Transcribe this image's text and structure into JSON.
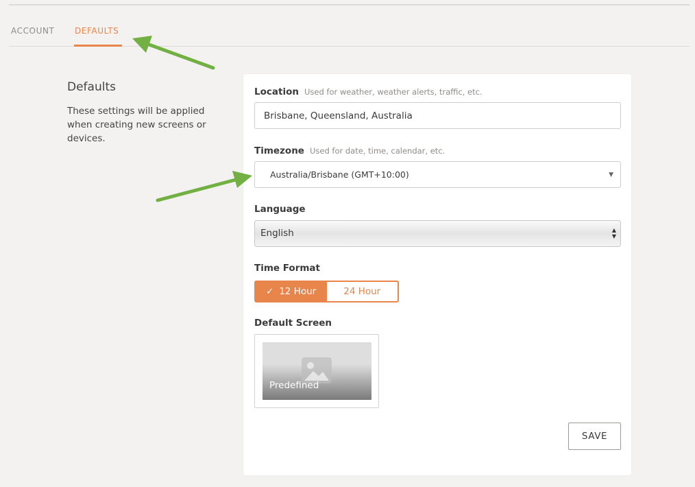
{
  "tabs": [
    {
      "label": "ACCOUNT",
      "active": false
    },
    {
      "label": "DEFAULTS",
      "active": true
    }
  ],
  "section": {
    "title": "Defaults",
    "description": "These settings will be applied when creating new screens or devices."
  },
  "form": {
    "location": {
      "label": "Location",
      "hint": "Used for weather, weather alerts, traffic, etc.",
      "value": "Brisbane, Queensland, Australia"
    },
    "timezone": {
      "label": "Timezone",
      "hint": "Used for date, time, calendar, etc.",
      "value": "Australia/Brisbane (GMT+10:00)"
    },
    "language": {
      "label": "Language",
      "value": "English"
    },
    "time_format": {
      "label": "Time Format",
      "options": [
        "12 Hour",
        "24 Hour"
      ],
      "selected": "12 Hour"
    },
    "default_screen": {
      "label": "Default Screen",
      "name": "Predefined"
    },
    "save_label": "SAVE"
  },
  "colors": {
    "accent": "#e8854a",
    "annotation_arrow": "#72b043",
    "background": "#f3f2f0"
  }
}
